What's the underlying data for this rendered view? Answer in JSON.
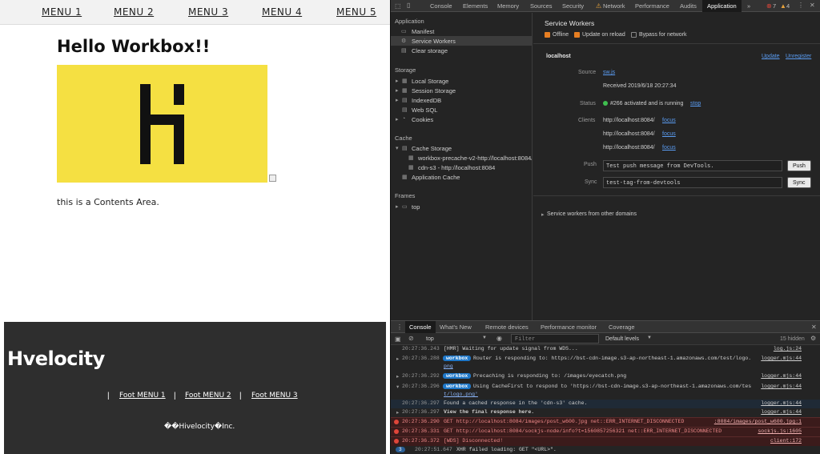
{
  "page": {
    "nav": [
      "MENU 1",
      "MENU 2",
      "MENU 3",
      "MENU 4",
      "MENU 5"
    ],
    "title": "Hello Workbox!!",
    "contents": "this is a Contents Area.",
    "footer": {
      "logo": "Hvelocity",
      "links": [
        "Foot MENU 1",
        "Foot MENU 2",
        "Foot MENU 3"
      ],
      "separator": "|",
      "copyright": "��Hivelocity�Inc."
    },
    "hero_color": "#f5e042"
  },
  "devtools": {
    "tabs": [
      "Console",
      "Elements",
      "Memory",
      "Sources",
      "Security",
      "Network",
      "Performance",
      "Audits",
      "Application"
    ],
    "active_tab": "Application",
    "more": "»",
    "error_count": "7",
    "warning_count": "4",
    "sidebar": {
      "application_header": "Application",
      "application_items": [
        "Manifest",
        "Service Workers",
        "Clear storage"
      ],
      "storage_header": "Storage",
      "storage_items": [
        "Local Storage",
        "Session Storage",
        "IndexedDB",
        "Web SQL",
        "Cookies"
      ],
      "cache_header": "Cache",
      "cache_items": [
        "Cache Storage",
        "workbox-precache-v2-http://localhost:8084/",
        "cdn-s3 - http://localhost:8084",
        "Application Cache"
      ],
      "frames_header": "Frames",
      "frames_items": [
        "top"
      ]
    },
    "sw": {
      "heading": "Service Workers",
      "offline": "Offline",
      "update_on_reload": "Update on reload",
      "bypass": "Bypass for network",
      "host": "localhost",
      "update": "Update",
      "unregister": "Unregister",
      "source_label": "Source",
      "source": "sw.js",
      "received": "Received 2019/6/18 20:27:34",
      "status_label": "Status",
      "status": "#266 activated and is running",
      "stop": "stop",
      "clients_label": "Clients",
      "clients": [
        "http://localhost:8084/",
        "http://localhost:8084/",
        "http://localhost:8084/"
      ],
      "focus": "focus",
      "push_label": "Push",
      "push_value": "Test push message from DevTools.",
      "push_btn": "Push",
      "sync_label": "Sync",
      "sync_value": "test-tag-from-devtools",
      "sync_btn": "Sync",
      "other_domains": "Service workers from other domains"
    },
    "console": {
      "tabs": [
        "Console",
        "What's New",
        "Remote devices",
        "Performance monitor",
        "Coverage"
      ],
      "context": "top",
      "filter_placeholder": "Filter",
      "levels": "Default levels",
      "hidden": "15 hidden",
      "rows": [
        {
          "ts": "20:27:36.243",
          "msg": "[HMR] Waiting for update signal from WDS...",
          "src": "log.js:24"
        },
        {
          "ts": "20:27:36.288",
          "badge": "workbox",
          "msg": "Router is responding to: https://bst-cdn-image.s3-ap-northeast-1.amazonaws.com/test/logo.",
          "cont": "png",
          "src": "logger.mjs:44"
        },
        {
          "ts": "20:27:36.292",
          "badge": "workbox",
          "msg": "Precaching is responding to: /images/eyecatch.png",
          "src": "logger.mjs:44"
        },
        {
          "ts": "20:27:36.296",
          "badge": "workbox",
          "msg": "Using CacheFirst to respond to 'https://bst-cdn-image.s3-ap-northeast-1.amazonaws.com/tes",
          "cont": "t/logo.png'",
          "src": "logger.mjs:44"
        },
        {
          "ts": "20:27:36.297",
          "msg": "Found a cached response in the 'cdn-s3' cache.",
          "src": "logger.mjs:44"
        },
        {
          "ts": "20:27:36.297",
          "msg": "View the final response here.",
          "src": "logger.mjs:44"
        },
        {
          "ts": "20:27:36.290",
          "msg": "GET http://localhost:8084/images/post_w600.jpg net::ERR_INTERNET_DISCONNECTED",
          "src": ":8084/images/post_w600.jpg:1",
          "err": true
        },
        {
          "ts": "20:27:36.331",
          "msg": "GET http://localhost:8084/sockjs-node/info?t=1560857256321 net::ERR_INTERNET_DISCONNECTED",
          "src": "sockjs.js:1605",
          "err": true
        },
        {
          "ts": "20:27:36.372",
          "msg": "[WDS] Disconnected!",
          "src": "client:172",
          "err": true
        },
        {
          "ts": "20:27:51.647",
          "msg": "XHR failed loading: GET \"<URL>\".",
          "badge2": "3"
        }
      ]
    }
  }
}
